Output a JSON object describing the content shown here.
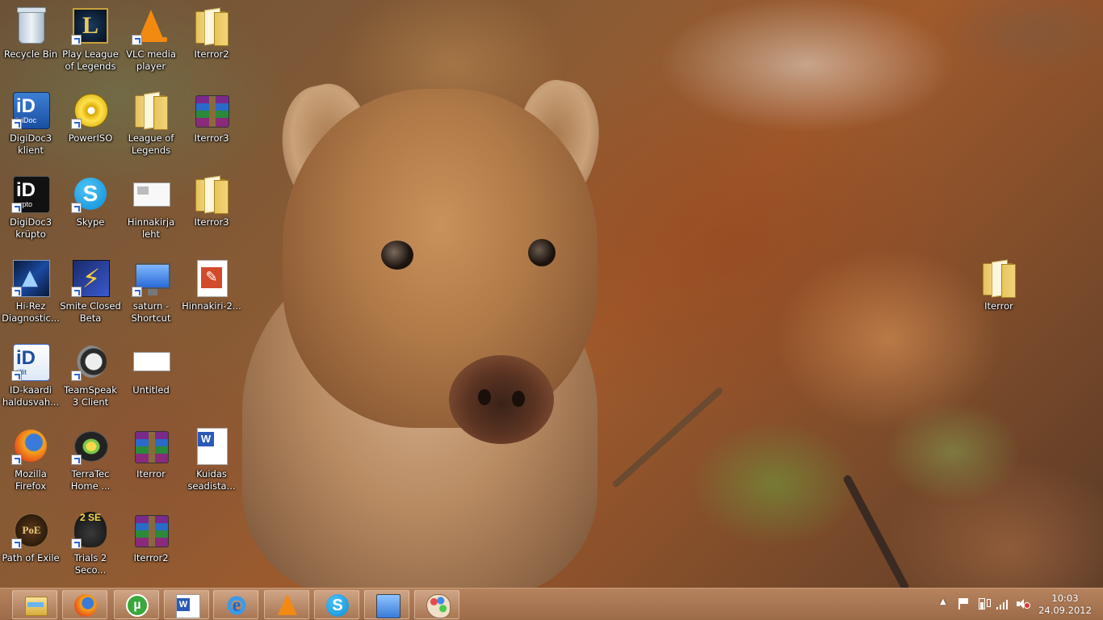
{
  "desktop": {
    "icons": [
      {
        "label": "Recycle Bin",
        "icon": "recycle-bin-icon"
      },
      {
        "label": "Play League of Legends",
        "icon": "league-of-legends-icon"
      },
      {
        "label": "VLC media player",
        "icon": "vlc-icon"
      },
      {
        "label": "Iterror2",
        "icon": "folder-icon"
      },
      {
        "label": "DigiDoc3 klient",
        "icon": "digidoc-icon",
        "glyph": "iD",
        "sub": "igiDoc"
      },
      {
        "label": "PowerISO",
        "icon": "poweriso-icon"
      },
      {
        "label": "League of Legends",
        "icon": "folder-icon"
      },
      {
        "label": "Iterror3",
        "icon": "winrar-archive-icon"
      },
      {
        "label": "DigiDoc3 krüpto",
        "icon": "digidoc-crypto-icon",
        "glyph": "iD",
        "sub": "rypto"
      },
      {
        "label": "Skype",
        "icon": "skype-icon",
        "glyph": "S"
      },
      {
        "label": "Hinnakirja leht",
        "icon": "document-icon"
      },
      {
        "label": "Iterror3",
        "icon": "folder-icon"
      },
      {
        "label": "Hi-Rez Diagnostic...",
        "icon": "hirez-icon"
      },
      {
        "label": "Smite Closed Beta",
        "icon": "smite-icon",
        "glyph": "⚡"
      },
      {
        "label": "saturn - Shortcut",
        "icon": "network-computer-icon"
      },
      {
        "label": "Hinnakiri-2...",
        "icon": "pdf-document-icon"
      },
      {
        "label": "ID-kaardi haldusvah...",
        "icon": "id-card-icon",
        "glyph": "iD",
        "sub": "tillit"
      },
      {
        "label": "TeamSpeak 3 Client",
        "icon": "teamspeak-icon"
      },
      {
        "label": "Untitled",
        "icon": "image-file-icon"
      },
      {
        "label": "Mozilla Firefox",
        "icon": "firefox-icon"
      },
      {
        "label": "TerraTec Home ...",
        "icon": "terratec-icon"
      },
      {
        "label": "Iterror",
        "icon": "winrar-archive-icon"
      },
      {
        "label": "Kuidas seadista...",
        "icon": "word-document-icon"
      },
      {
        "label": "Path of Exile",
        "icon": "path-of-exile-icon",
        "glyph": "PoE"
      },
      {
        "label": "Trials 2 Seco...",
        "icon": "trials-icon",
        "glyph": "2 SE"
      },
      {
        "label": "Iterror2",
        "icon": "winrar-archive-icon"
      },
      {
        "label": "Iterror",
        "icon": "folder-icon"
      }
    ]
  },
  "taskbar": {
    "pinned": [
      {
        "name": "File Explorer",
        "icon": "file-explorer-icon"
      },
      {
        "name": "Mozilla Firefox",
        "icon": "firefox-icon"
      },
      {
        "name": "uTorrent",
        "icon": "utorrent-icon",
        "glyph": "µ"
      },
      {
        "name": "Microsoft Word",
        "icon": "word-icon"
      },
      {
        "name": "Internet Explorer",
        "icon": "internet-explorer-icon",
        "glyph": "e"
      },
      {
        "name": "VLC media player",
        "icon": "vlc-icon"
      },
      {
        "name": "Skype",
        "icon": "skype-icon",
        "glyph": "S"
      },
      {
        "name": "Control Panel",
        "icon": "control-panel-icon"
      },
      {
        "name": "Paint",
        "icon": "paint-icon"
      }
    ],
    "tray": {
      "chevron": "▲",
      "time": "10:03",
      "date": "24.09.2012"
    }
  }
}
